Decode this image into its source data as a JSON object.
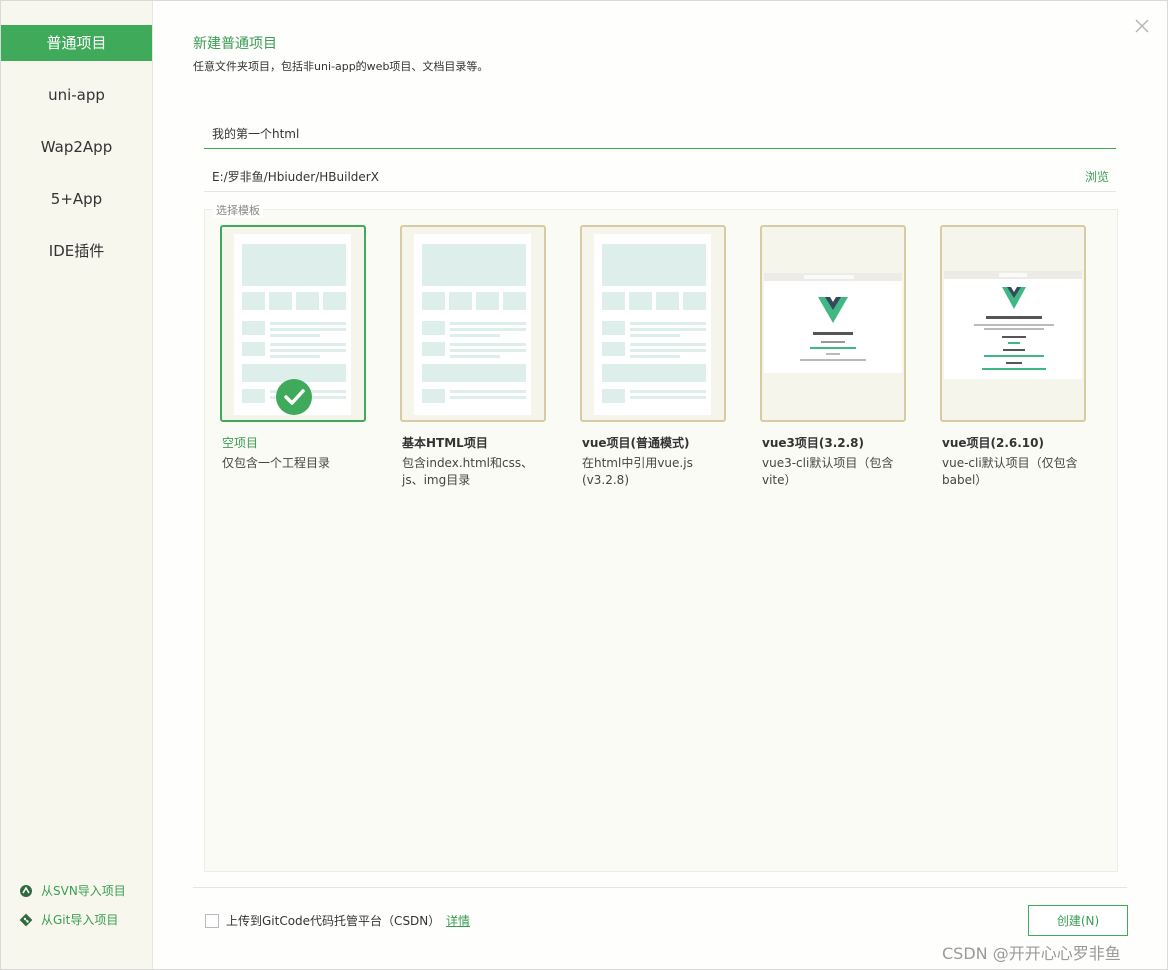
{
  "sidebar": {
    "items": [
      {
        "label": "普通项目",
        "active": true
      },
      {
        "label": "uni-app",
        "active": false
      },
      {
        "label": "Wap2App",
        "active": false
      },
      {
        "label": "5+App",
        "active": false
      },
      {
        "label": "IDE插件",
        "active": false
      }
    ],
    "import_svn": "从SVN导入项目",
    "import_git": "从Git导入项目"
  },
  "header": {
    "title": "新建普通项目",
    "subtitle": "任意文件夹项目，包括非uni-app的web项目、文档目录等。"
  },
  "form": {
    "project_name": "我的第一个html",
    "project_path": "E:/罗非鱼/Hbiuder/HBuilderX",
    "browse_label": "浏览"
  },
  "templates": {
    "legend": "选择模板",
    "items": [
      {
        "name": "空项目",
        "desc": "仅包含一个工程目录",
        "selected": true
      },
      {
        "name": "基本HTML项目",
        "desc": "包含index.html和css、js、img目录",
        "selected": false
      },
      {
        "name": "vue项目(普通模式)",
        "desc": "在html中引用vue.js (v3.2.8)",
        "selected": false
      },
      {
        "name": "vue3项目(3.2.8)",
        "desc": "vue3-cli默认项目（包含vite）",
        "selected": false
      },
      {
        "name": "vue项目(2.6.10)",
        "desc": "vue-cli默认项目（仅包含babel）",
        "selected": false
      }
    ]
  },
  "footer": {
    "upload_label": "上传到GitCode代码托管平台（CSDN）",
    "upload_checked": false,
    "detail_label": "详情",
    "create_label": "创建(N)"
  },
  "watermark": "CSDN @开开心心罗非鱼",
  "colors": {
    "accent": "#3fab5a",
    "sidebar_bg": "#f7f7ee",
    "card_border": "#d6cba3",
    "vue_green": "#41b883",
    "vue_dark": "#34495e"
  }
}
